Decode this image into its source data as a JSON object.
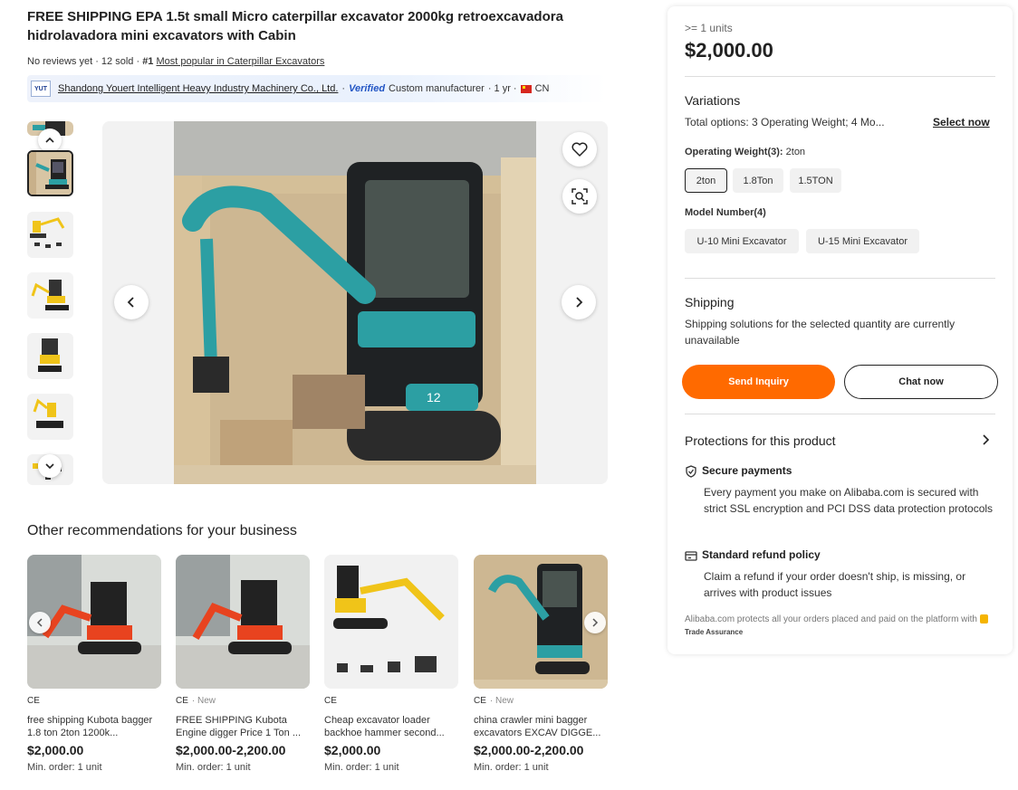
{
  "product": {
    "title": "FREE SHIPPING EPA 1.5t small Micro caterpillar excavator 2000kg retroexcavadora hidrolavadora mini excavators with Cabin",
    "reviews": "No reviews yet",
    "sold": "· 12 sold ·",
    "rank": "#1",
    "rank_link": "Most popular in Caterpillar Excavators"
  },
  "supplier": {
    "logo_text": "YUT",
    "name": "Shandong Youert Intelligent Heavy Industry Machinery Co., Ltd.",
    "dot": "·",
    "verified": "Verified",
    "type": "Custom manufacturer",
    "years": "· 1 yr ·",
    "country": "CN"
  },
  "recommendations": {
    "title": "Other recommendations for your business",
    "items": [
      {
        "cert": "CE",
        "badge": "",
        "name": "free shipping Kubota bagger 1.8 ton 2ton 1200k...",
        "price": "$2,000.00",
        "min_order": "Min. order: 1 unit"
      },
      {
        "cert": "CE",
        "badge": "· New",
        "name": "FREE SHIPPING Kubota Engine digger Price 1 Ton ...",
        "price": "$2,000.00-2,200.00",
        "min_order": "Min. order: 1 unit"
      },
      {
        "cert": "CE",
        "badge": "",
        "name": "Cheap excavator loader backhoe hammer second...",
        "price": "$2,000.00",
        "min_order": "Min. order: 1 unit"
      },
      {
        "cert": "CE",
        "badge": "· New",
        "name": "china crawler mini bagger excavators EXCAV DIGGE...",
        "price": "$2,000.00-2,200.00",
        "min_order": "Min. order: 1 unit"
      }
    ]
  },
  "panel": {
    "units": ">= 1 units",
    "price": "$2,000.00",
    "variations_title": "Variations",
    "total_options": "Total options: 3 Operating Weight; 4 Mo...",
    "select_now": "Select now",
    "weight_label": "Operating Weight(3):",
    "weight_selected": "2ton",
    "weights": [
      "2ton",
      "1.8Ton",
      "1.5TON"
    ],
    "model_label": "Model Number(4)",
    "models": [
      "U-10 Mini Excavator",
      "U-15 Mini Excavator"
    ],
    "shipping_title": "Shipping",
    "shipping_text": "Shipping solutions for the selected quantity are currently unavailable",
    "send_inquiry": "Send Inquiry",
    "chat_now": "Chat now",
    "protections_title": "Protections for this product",
    "secure_title": "Secure payments",
    "secure_text": "Every payment you make on Alibaba.com is secured with strict SSL encryption and PCI DSS data protection protocols",
    "refund_title": "Standard refund policy",
    "refund_text": "Claim a refund if your order doesn't ship, is missing, or arrives with product issues",
    "footer_text": "Alibaba.com protects all your orders placed and paid on the platform with",
    "trade_assurance": "Trade Assurance"
  },
  "colors": {
    "accent": "#ff6a00",
    "excavator_teal": "#2c9fa3",
    "excavator_orange": "#e8431f",
    "excavator_yellow": "#f0c419"
  }
}
